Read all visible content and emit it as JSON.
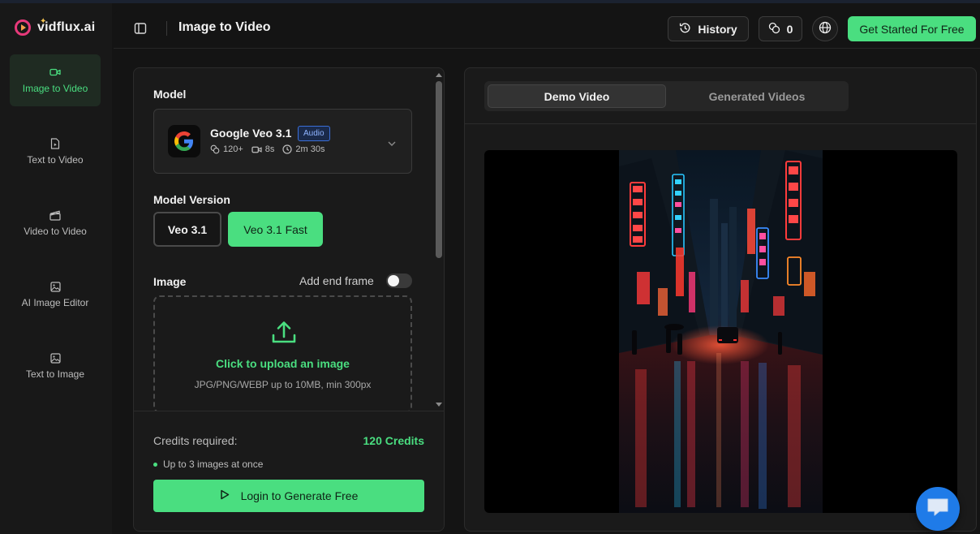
{
  "brand": {
    "name": "vidflux.ai",
    "accent": "#4ade80",
    "logo_color": "#e7397a"
  },
  "sidebar": {
    "items": [
      {
        "label": "Image to Video",
        "icon": "video-camera-icon",
        "active": true
      },
      {
        "label": "Text to Video",
        "icon": "file-video-icon",
        "active": false
      },
      {
        "label": "Video to Video",
        "icon": "clapperboard-icon",
        "active": false
      },
      {
        "label": "AI Image Editor",
        "icon": "image-icon",
        "active": false
      },
      {
        "label": "Text to Image",
        "icon": "image-icon",
        "active": false
      }
    ]
  },
  "header": {
    "title": "Image to Video",
    "history_label": "History",
    "credits_count": "0",
    "cta_label": "Get Started For Free"
  },
  "form": {
    "model_label": "Model",
    "model": {
      "name": "Google Veo 3.1",
      "badge": "Audio",
      "credits": "120+",
      "duration": "8s",
      "time": "2m 30s"
    },
    "version_label": "Model Version",
    "versions": [
      {
        "label": "Veo 3.1",
        "selected": false
      },
      {
        "label": "Veo 3.1 Fast",
        "selected": true
      }
    ],
    "image_label": "Image",
    "end_frame_label": "Add end frame",
    "end_frame_enabled": false,
    "upload_title": "Click to upload an image",
    "upload_hint": "JPG/PNG/WEBP up to 10MB, min 300px"
  },
  "footer": {
    "credits_label": "Credits required:",
    "credits_value": "120 Credits",
    "note": "Up to 3 images at once",
    "login_label": "Login to Generate Free"
  },
  "preview": {
    "tabs": [
      {
        "label": "Demo Video",
        "active": true
      },
      {
        "label": "Generated Videos",
        "active": false
      }
    ]
  }
}
